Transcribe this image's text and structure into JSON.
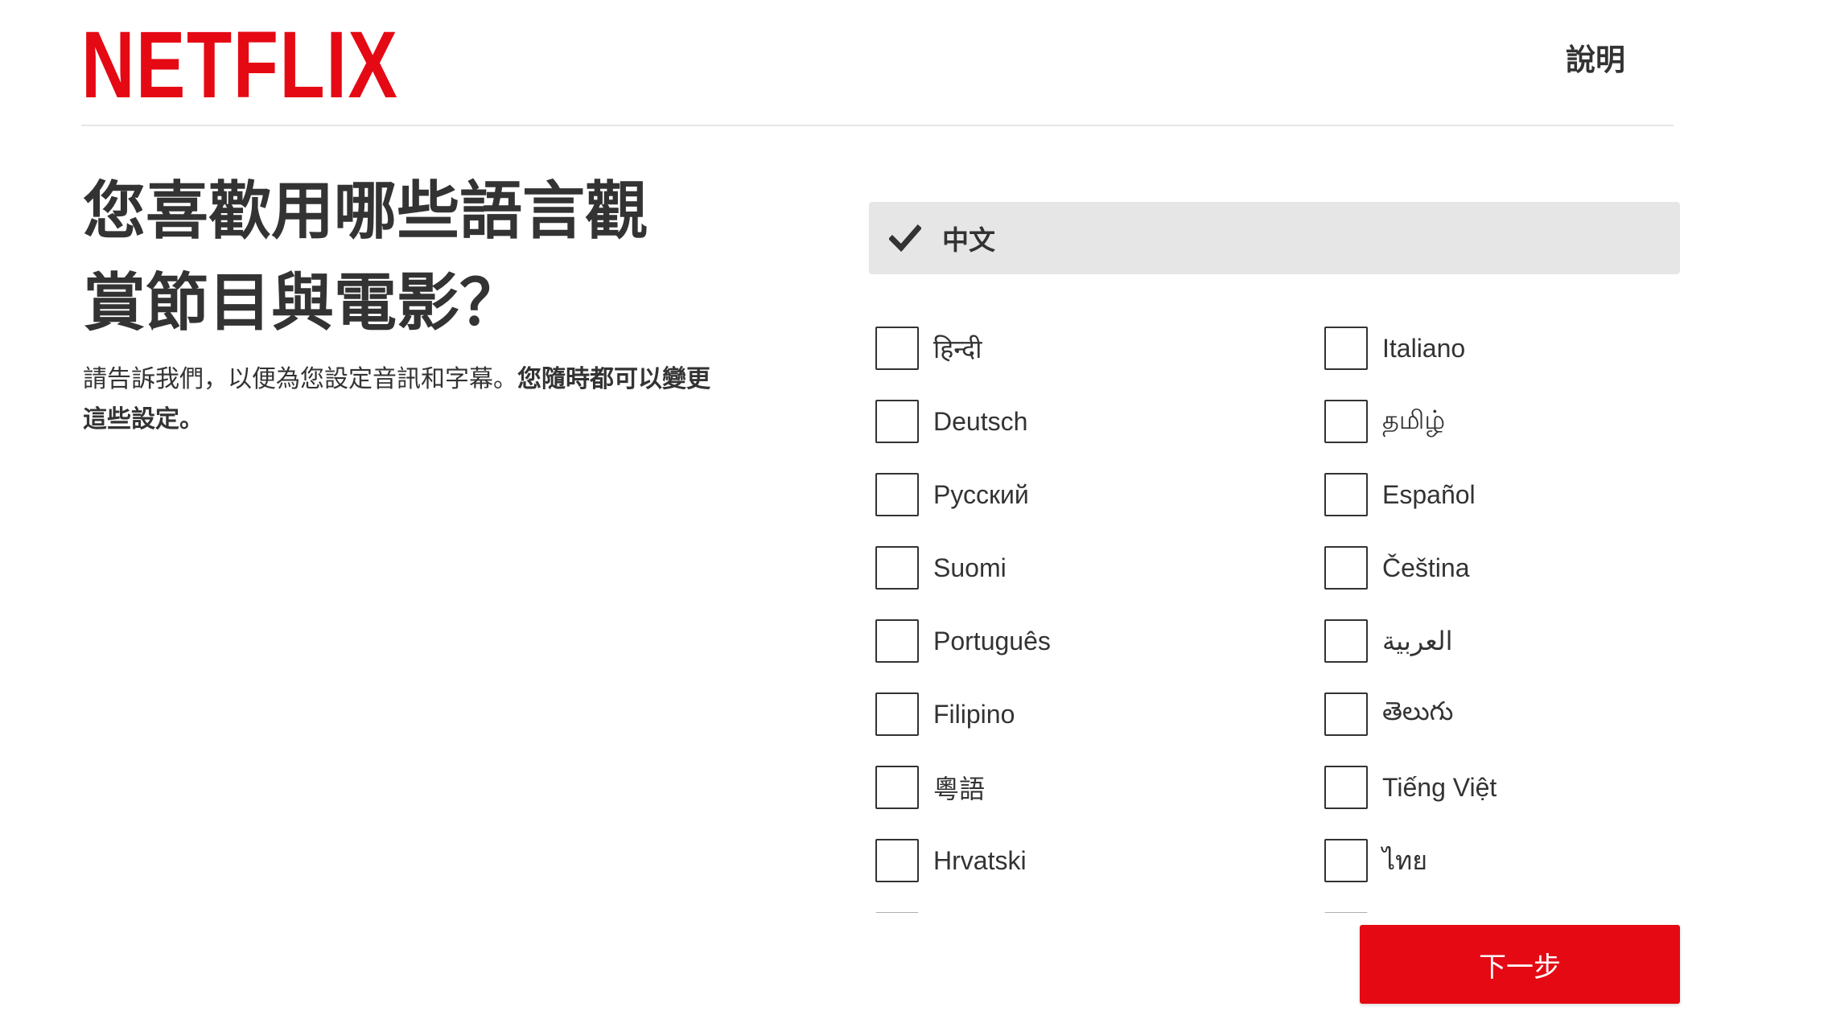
{
  "header": {
    "logo_text": "NETFLIX",
    "help_label": "說明"
  },
  "main": {
    "title_line1": "您喜歡用哪些語言觀",
    "title_line2": "賞節目與電影？",
    "subtitle_regular": "請告訴我們，以便為您設定音訊和字幕。",
    "subtitle_bold": "您隨時都可以變更這些設定。"
  },
  "selected_language": {
    "label": "中文",
    "icon": "checkmark-icon"
  },
  "languages_left": [
    {
      "label": "हिन्दी",
      "checked": false
    },
    {
      "label": "Deutsch",
      "checked": false
    },
    {
      "label": "Русский",
      "checked": false
    },
    {
      "label": "Suomi",
      "checked": false
    },
    {
      "label": "Português",
      "checked": false
    },
    {
      "label": "Filipino",
      "checked": false
    },
    {
      "label": "粵語",
      "checked": false
    },
    {
      "label": "Hrvatski",
      "checked": false
    }
  ],
  "languages_right": [
    {
      "label": "Italiano",
      "checked": false
    },
    {
      "label": "தமிழ்",
      "checked": false
    },
    {
      "label": "Español",
      "checked": false
    },
    {
      "label": "Čeština",
      "checked": false
    },
    {
      "label": "العربية",
      "checked": false
    },
    {
      "label": "తెలుగు",
      "checked": false
    },
    {
      "label": "Tiếng Việt",
      "checked": false
    },
    {
      "label": "ไทย",
      "checked": false
    }
  ],
  "footer": {
    "next_label": "下一步"
  },
  "colors": {
    "brand_red": "#e50914",
    "selected_bg": "#e6e6e6",
    "text": "#333333"
  }
}
